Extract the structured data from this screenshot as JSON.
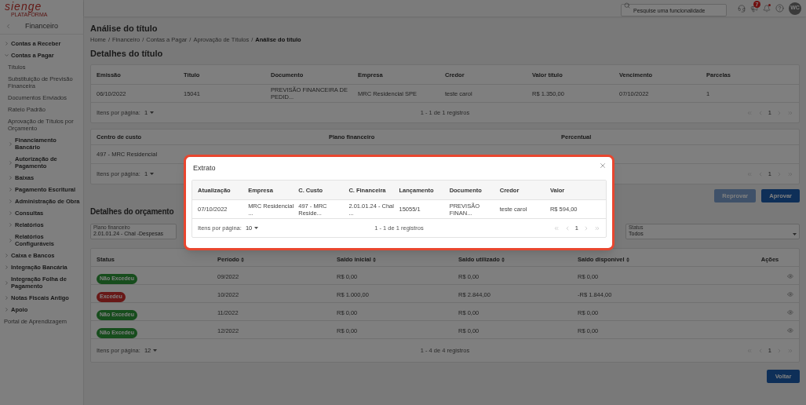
{
  "top_bar": {
    "search": {
      "placeholder": "Pesquise uma funcionalidade"
    },
    "notifications_badge": "7",
    "alerts_dot": true,
    "avatar": "WC"
  },
  "sidebar": {
    "logo": {
      "name": "sienge",
      "tagline": "PLATAFORMA"
    },
    "title": "Financeiro",
    "items": [
      {
        "label": "Contas a Receber",
        "expanded": false
      },
      {
        "label": "Contas a Pagar",
        "expanded": true,
        "children": [
          {
            "label": "Títulos"
          },
          {
            "label": "Substituição de Previsão Financeira"
          },
          {
            "label": "Documentos Enviados"
          },
          {
            "label": "Rateio Padrão"
          },
          {
            "label": "Aprovação de Títulos por Orçamento"
          },
          {
            "label": "Financiamento Bancário",
            "expanded": false
          },
          {
            "label": "Autorização de Pagamento",
            "expanded": false
          },
          {
            "label": "Baixas",
            "expanded": false
          },
          {
            "label": "Pagamento Escritural",
            "expanded": false
          },
          {
            "label": "Administração de Obra",
            "expanded": false
          },
          {
            "label": "Consultas",
            "expanded": false
          },
          {
            "label": "Relatórios",
            "expanded": false
          },
          {
            "label": "Relatórios Configuráveis",
            "expanded": false
          }
        ]
      },
      {
        "label": "Caixa e Bancos",
        "expanded": false
      },
      {
        "label": "Integração Bancária",
        "expanded": false
      },
      {
        "label": "Integração Folha de Pagamento",
        "expanded": false
      },
      {
        "label": "Notas Fiscais Antigo",
        "expanded": false
      },
      {
        "label": "Apoio",
        "expanded": false
      },
      {
        "label": "Portal de Aprendizagem"
      }
    ]
  },
  "page": {
    "title": "Análise do título",
    "breadcrumb_separator": "/",
    "breadcrumb": [
      {
        "label": "Home",
        "current": false
      },
      {
        "label": "Financeiro",
        "current": false
      },
      {
        "label": "Contas a Pagar",
        "current": false
      },
      {
        "label": "Aprovação de Títulos",
        "current": false
      },
      {
        "label": "Análise do título",
        "current": true
      }
    ]
  },
  "title_details": {
    "heading": "Detalhes do título",
    "columns": [
      "Emissão",
      "Título",
      "Documento",
      "Empresa",
      "Credor",
      "Valor título",
      "Vencimento",
      "Parcelas"
    ],
    "rows": [
      [
        "06/10/2022",
        "15041",
        "PREVISÃO FINANCEIRA DE PEDID...",
        "MRC Residencial SPE",
        "teste carol",
        "R$ 1.350,00",
        "07/10/2022",
        "1"
      ]
    ],
    "footer": {
      "per_page_label": "Itens por página:",
      "per_page": "1",
      "range": "1 - 1 de 1 registros",
      "page": "1"
    }
  },
  "cost_centers": {
    "columns": [
      "Centro de custo",
      "Plano financeiro",
      "Percentual"
    ],
    "rows": [
      [
        "497 - MRC Residencial"
      ]
    ],
    "footer": {
      "per_page_label": "Itens por página:",
      "per_page": "1",
      "page": "1"
    }
  },
  "actions": [
    {
      "label": "Reprovar",
      "disabled": true
    },
    {
      "label": "Aprovar",
      "disabled": false
    }
  ],
  "budget": {
    "heading": "Detalhes do orçamento",
    "filters": [
      {
        "label": "Plano financeiro",
        "value": "2.01.01.24 - Chal -Despesas"
      },
      {
        "label": "Status",
        "value": "Todos"
      }
    ],
    "columns": [
      {
        "label": "Status",
        "sortable": false
      },
      {
        "label": "Período",
        "sortable": true
      },
      {
        "label": "Saldo inicial",
        "sortable": true
      },
      {
        "label": "Saldo utilizado",
        "sortable": true
      },
      {
        "label": "Saldo disponível",
        "sortable": true
      },
      {
        "label": "Ações",
        "sortable": false
      }
    ],
    "rows": [
      {
        "status": "Não Excedeu",
        "kind": "ok",
        "period": "09/2022",
        "initial": "R$ 0,00",
        "used": "R$ 0,00",
        "available": "R$ 0,00"
      },
      {
        "status": "Excedeu",
        "kind": "exceeded",
        "period": "10/2022",
        "initial": "R$ 1.000,00",
        "used": "R$ 2.844,00",
        "available": "-R$ 1.844,00"
      },
      {
        "status": "Não Excedeu",
        "kind": "ok",
        "period": "11/2022",
        "initial": "R$ 0,00",
        "used": "R$ 0,00",
        "available": "R$ 0,00"
      },
      {
        "status": "Não Excedeu",
        "kind": "ok",
        "period": "12/2022",
        "initial": "R$ 0,00",
        "used": "R$ 0,00",
        "available": "R$ 0,00"
      }
    ],
    "footer": {
      "per_page_label": "Itens por página:",
      "per_page": "12",
      "range": "1 - 4 de 4 registros",
      "page": "1"
    }
  },
  "back_button": "Voltar",
  "modal": {
    "title": "Extrato",
    "columns": [
      "Atualização",
      "Empresa",
      "C. Custo",
      "C. Financeira",
      "Lançamento",
      "Documento",
      "Credor",
      "Valor"
    ],
    "rows": [
      [
        "07/10/2022",
        "MRC Residencial ...",
        "497 - MRC Reside...",
        "2.01.01.24 - Chal ...",
        "15055/1",
        "PREVISÃO FINAN...",
        "teste carol",
        "R$ 594,00"
      ]
    ],
    "footer": {
      "per_page_label": "Itens por página:",
      "per_page": "10",
      "range": "1 - 1 de 1 registros",
      "page": "1"
    }
  }
}
